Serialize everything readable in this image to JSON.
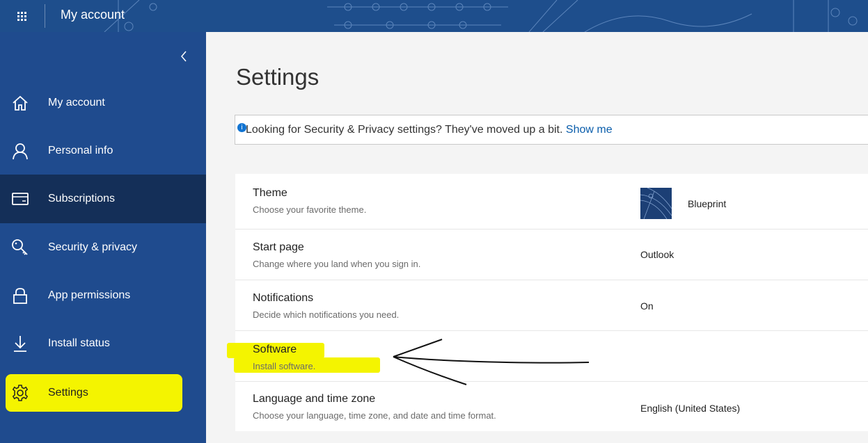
{
  "header": {
    "title": "My account"
  },
  "sidebar": {
    "items": [
      {
        "label": "My account"
      },
      {
        "label": "Personal info"
      },
      {
        "label": "Subscriptions"
      },
      {
        "label": "Security & privacy"
      },
      {
        "label": "App permissions"
      },
      {
        "label": "Install status"
      },
      {
        "label": "Settings"
      }
    ]
  },
  "main": {
    "title": "Settings",
    "info_banner": {
      "message": "Looking for Security & Privacy settings? They've moved up a bit.",
      "link": "Show me"
    },
    "settings": [
      {
        "title": "Theme",
        "description": "Choose your favorite theme.",
        "value": "Blueprint"
      },
      {
        "title": "Start page",
        "description": "Change where you land when you sign in.",
        "value": "Outlook"
      },
      {
        "title": "Notifications",
        "description": "Decide which notifications you need.",
        "value": "On"
      },
      {
        "title": "Software",
        "description": "Install software.",
        "value": ""
      },
      {
        "title": "Language and time zone",
        "description": "Choose your language, time zone, and date and time format.",
        "value": "English (United States)"
      }
    ]
  },
  "colors": {
    "header_bg": "#1e4e8c",
    "sidebar_bg": "#1f4b8e",
    "sidebar_active": "#142f58",
    "accent_link": "#0a5dab",
    "highlight": "#f4f400"
  },
  "icons": {
    "app_launcher": "waffle-icon",
    "collapse": "chevron-left-icon",
    "nav": [
      "home-icon",
      "person-icon",
      "card-icon",
      "key-icon",
      "lock-icon",
      "download-icon",
      "gear-icon"
    ],
    "info": "info-icon"
  }
}
